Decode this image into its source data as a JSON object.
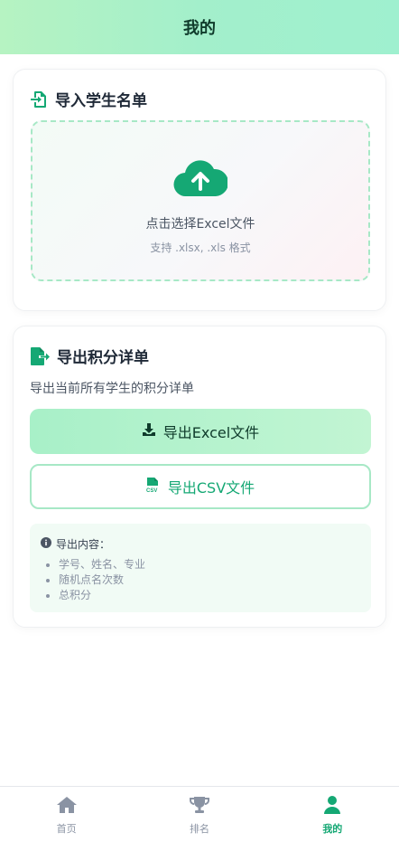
{
  "header": {
    "title": "我的"
  },
  "import_card": {
    "title": "导入学生名单",
    "dropzone": {
      "main_text": "点击选择Excel文件",
      "sub_text": "支持 .xlsx, .xls 格式"
    }
  },
  "export_card": {
    "title": "导出积分详单",
    "description": "导出当前所有学生的积分详单",
    "excel_button": "导出Excel文件",
    "csv_button": "导出CSV文件",
    "info": {
      "title": "导出内容：",
      "items": [
        "学号、姓名、专业",
        "随机点名次数",
        "总积分"
      ]
    }
  },
  "tabbar": {
    "items": [
      {
        "label": "首页",
        "icon": "home-icon",
        "active": false
      },
      {
        "label": "排名",
        "icon": "trophy-icon",
        "active": false
      },
      {
        "label": "我的",
        "icon": "user-icon",
        "active": true
      }
    ]
  },
  "colors": {
    "accent": "#15a874",
    "header_gradient_start": "#b6f3c2",
    "header_gradient_end": "#9ff0cf",
    "inactive": "#8a93a3"
  }
}
